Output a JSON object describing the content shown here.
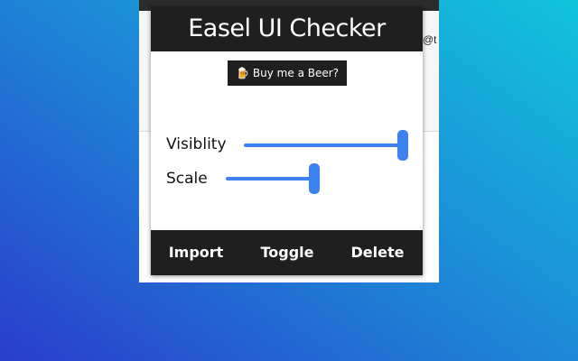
{
  "browser": {
    "peek_text": "@t"
  },
  "popup": {
    "title": "Easel UI Checker",
    "donate_label": "Buy me a Beer?",
    "sliders": [
      {
        "label": "Visiblity",
        "value": 1.0
      },
      {
        "label": "Scale",
        "value": 0.5
      }
    ],
    "footer": {
      "import_label": "Import",
      "toggle_label": "Toggle",
      "delete_label": "Delete"
    }
  },
  "colors": {
    "accent": "#3b82f0",
    "dark": "#1f1f1f"
  }
}
